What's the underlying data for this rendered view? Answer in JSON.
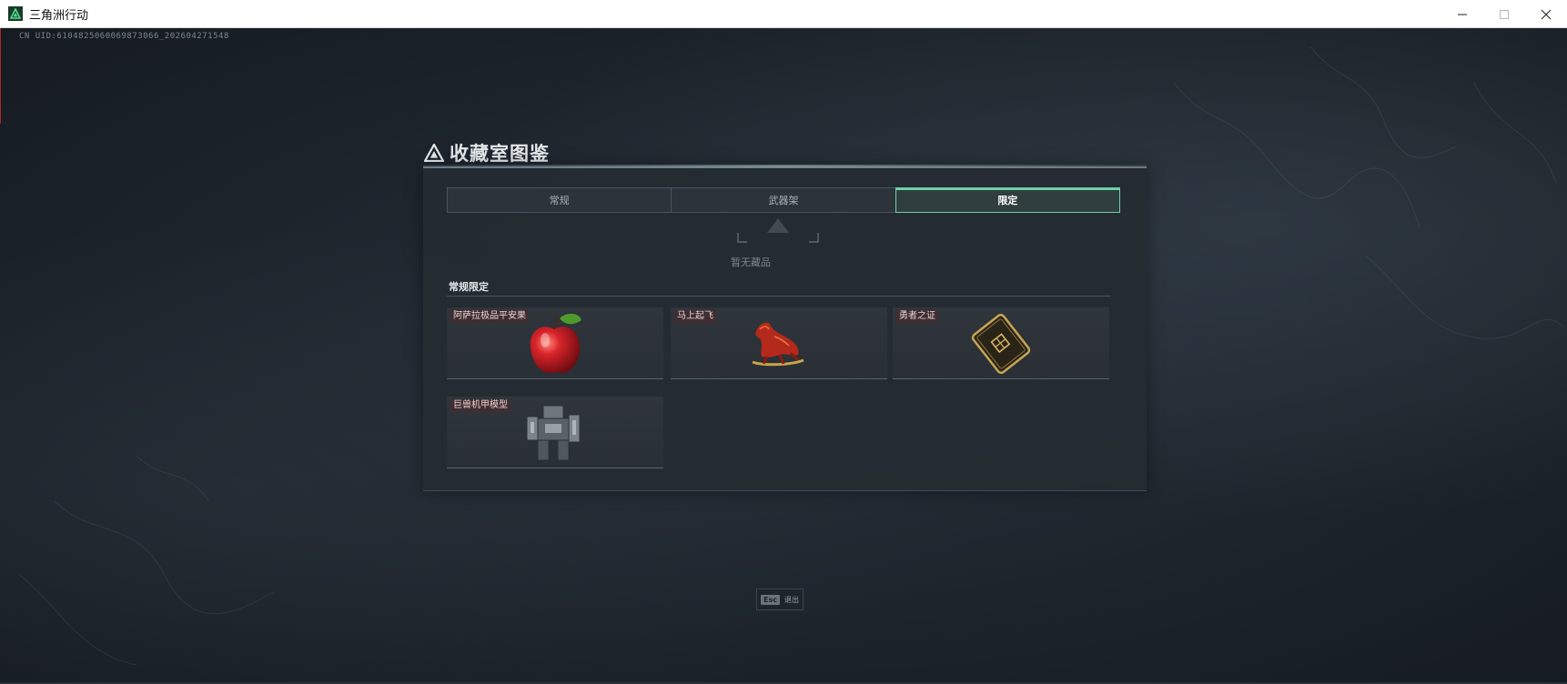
{
  "window": {
    "title": "三角洲行动",
    "controls": [
      "minimize",
      "maximize",
      "close"
    ]
  },
  "uid_text": "CN UID:6104825060069873066_202604271548",
  "panel": {
    "title": "收藏室图鉴",
    "tabs": [
      {
        "label": "常规",
        "active": false
      },
      {
        "label": "武器架",
        "active": false
      },
      {
        "label": "限定",
        "active": true
      }
    ],
    "empty_text": "暂无藏品",
    "section_title": "常规限定",
    "items": [
      {
        "label": "阿萨拉极品平安果",
        "icon": "apple-icon"
      },
      {
        "label": "马上起飞",
        "icon": "horse-icon"
      },
      {
        "label": "勇者之证",
        "icon": "card-icon"
      },
      {
        "label": "巨兽机甲模型",
        "icon": "mecha-icon"
      }
    ]
  },
  "esc_hint": {
    "key": "Esc",
    "label": "退出"
  },
  "colors": {
    "accent": "#6ed0a6",
    "label_bg": "#3f2e31",
    "panel_bg": "#252b32"
  }
}
